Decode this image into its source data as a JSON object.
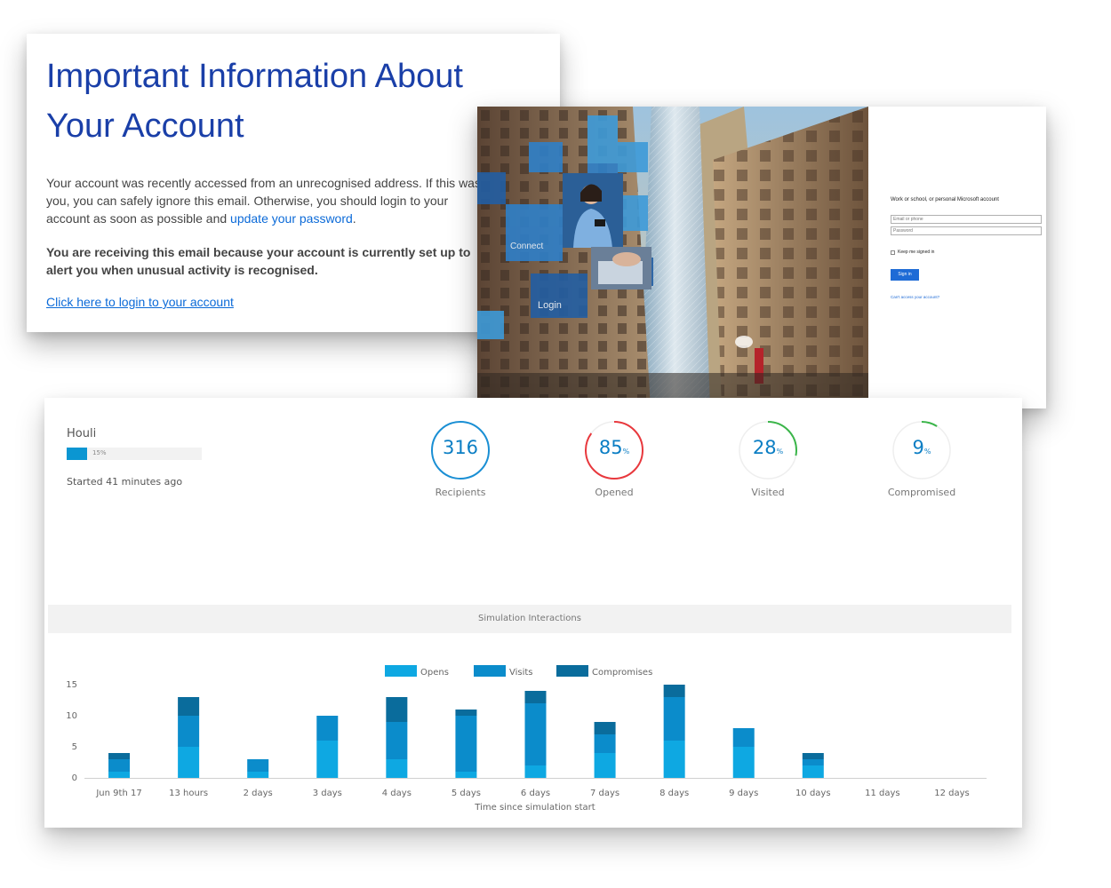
{
  "email": {
    "title_line1": "Important Information About",
    "title_line2": "Your Account",
    "body_text": "Your account was recently accessed from an unrecognised address. If this was you, you can safely ignore this email. Otherwise, you should login to your account as soon as possible and ",
    "body_link": "update your password",
    "body_end": ".",
    "bold_text": "You are receiving this email because your account is currently set up to alert you when unusual activity is recognised.",
    "cta_link": "Click here to login to your account"
  },
  "login": {
    "tile_connect": "Connect",
    "tile_login": "Login",
    "heading": "Work or school, or personal Microsoft account",
    "email_placeholder": "Email or phone",
    "password_placeholder": "Password",
    "keep_signed_in": "Keep me signed in",
    "sign_in_button": "Sign in",
    "cant_access_link": "Can't access your account?"
  },
  "simulation": {
    "name": "Houli",
    "progress_percent": 15,
    "progress_label": "15%",
    "started_text": "Started 41 minutes ago"
  },
  "stats": [
    {
      "value": "316",
      "suffix": "",
      "label": "Recipients",
      "fraction": 1.0,
      "color": "#1a8fd4"
    },
    {
      "value": "85",
      "suffix": "%",
      "label": "Opened",
      "fraction": 0.85,
      "color": "#e8383d"
    },
    {
      "value": "28",
      "suffix": "%",
      "label": "Visited",
      "fraction": 0.28,
      "color": "#3bb54a"
    },
    {
      "value": "9",
      "suffix": "%",
      "label": "Compromised",
      "fraction": 0.09,
      "color": "#3bb54a"
    }
  ],
  "interactions_header": "Simulation Interactions",
  "colors": {
    "opens": "#0ea8e2",
    "visits": "#0b8ccb",
    "compromises": "#0a6c9c",
    "accent_blue": "#1a3fa8"
  },
  "chart_data": {
    "type": "bar",
    "stacked": true,
    "categories": [
      "Jun 9th 17",
      "13 hours",
      "2 days",
      "3 days",
      "4 days",
      "5 days",
      "6 days",
      "7 days",
      "8 days",
      "9 days",
      "10 days",
      "11 days",
      "12 days"
    ],
    "series": [
      {
        "name": "Opens",
        "values": [
          1,
          5,
          1,
          6,
          3,
          1,
          2,
          4,
          6,
          5,
          2,
          0,
          0
        ]
      },
      {
        "name": "Visits",
        "values": [
          2,
          5,
          2,
          4,
          6,
          9,
          10,
          3,
          7,
          3,
          1,
          0,
          0
        ]
      },
      {
        "name": "Compromises",
        "values": [
          1,
          3,
          0,
          0,
          4,
          1,
          2,
          2,
          2,
          0,
          1,
          0,
          0
        ]
      }
    ],
    "xlabel": "Time since simulation start",
    "ylabel": "",
    "yticks": [
      0,
      5,
      10,
      15
    ],
    "ylim": [
      0,
      15
    ],
    "legend_position": "top-center"
  }
}
